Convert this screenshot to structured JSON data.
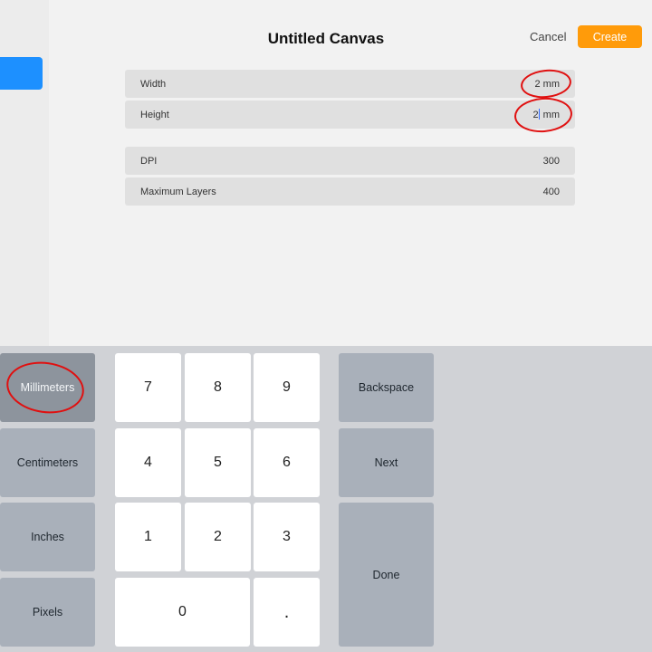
{
  "header": {
    "title": "Untitled Canvas",
    "cancel_label": "Cancel",
    "create_label": "Create"
  },
  "colors": {
    "accent": "#ff9b0a",
    "sidebar_tab": "#1d90ff",
    "annotation": "#e01010"
  },
  "fields": [
    {
      "label": "Width",
      "value": "2 mm"
    },
    {
      "label": "Height",
      "value_before_caret": "2",
      "value_after_caret": " mm"
    },
    {
      "label": "DPI",
      "value": "300"
    },
    {
      "label": "Maximum Layers",
      "value": "400"
    }
  ],
  "keyboard": {
    "units": [
      "Millimeters",
      "Centimeters",
      "Inches",
      "Pixels"
    ],
    "selected_unit": "Millimeters",
    "digits": [
      "7",
      "8",
      "9",
      "4",
      "5",
      "6",
      "1",
      "2",
      "3",
      "0",
      "."
    ],
    "backspace_label": "Backspace",
    "next_label": "Next",
    "done_label": "Done"
  }
}
